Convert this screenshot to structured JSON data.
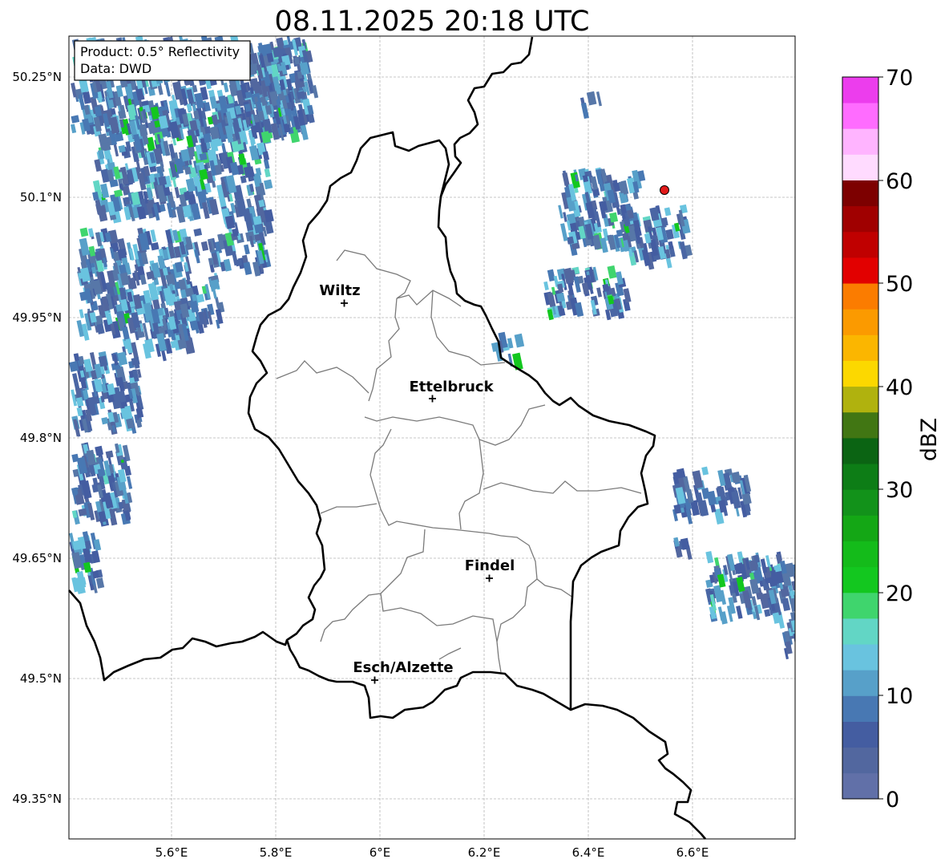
{
  "title": "08.11.2025 20:18 UTC",
  "info_box": {
    "line1": "Product: 0.5° Reflectivity",
    "line2": "Data: DWD"
  },
  "lat_ticks": [
    "50.25°N",
    "50.1°N",
    "49.95°N",
    "49.8°N",
    "49.65°N",
    "49.5°N",
    "49.35°N"
  ],
  "lon_ticks": [
    "5.6°E",
    "5.8°E",
    "6°E",
    "6.2°E",
    "6.4°E",
    "6.6°E"
  ],
  "cities": [
    {
      "name": "Wiltz"
    },
    {
      "name": "Ettelbruck"
    },
    {
      "name": "Findel"
    },
    {
      "name": "Esch/Alzette"
    }
  ],
  "colorbar": {
    "label": "dBZ",
    "ticks": [
      "0",
      "10",
      "20",
      "30",
      "40",
      "50",
      "60",
      "70"
    ],
    "colors": [
      "#6170a8",
      "#52679f",
      "#445da1",
      "#4878b3",
      "#57a0c9",
      "#69c3df",
      "#62d6c5",
      "#3fd56d",
      "#13c71f",
      "#14bb1a",
      "#14a715",
      "#12921a",
      "#0d7d16",
      "#0b6413",
      "#417613",
      "#b0b20e",
      "#fcd800",
      "#fbb600",
      "#fb9a00",
      "#fb7c00",
      "#e20000",
      "#c00000",
      "#a00000",
      "#7d0000",
      "#ffdbff",
      "#ffb4ff",
      "#ff6cff",
      "#ec3ded"
    ]
  },
  "marker": {
    "color": "#e21a1a"
  }
}
